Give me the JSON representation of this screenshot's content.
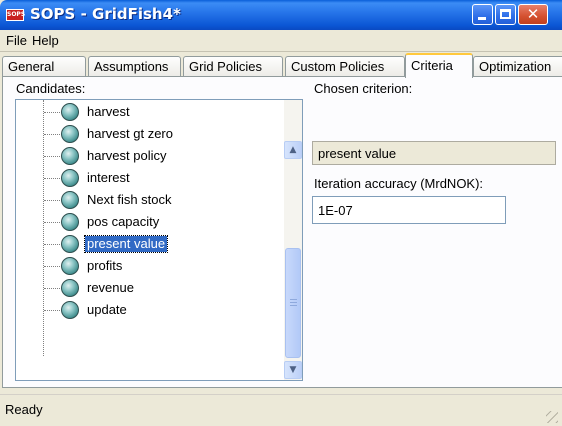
{
  "window": {
    "app_icon_text": "SOPS",
    "title": "SOPS - GridFish4*"
  },
  "menu": {
    "file": "File",
    "help": "Help"
  },
  "tabs": [
    {
      "label": "General"
    },
    {
      "label": "Assumptions"
    },
    {
      "label": "Grid Policies"
    },
    {
      "label": "Custom Policies"
    },
    {
      "label": "Criteria"
    },
    {
      "label": "Optimization"
    }
  ],
  "candidates": {
    "label": "Candidates:",
    "items": [
      {
        "label": "harvest"
      },
      {
        "label": "harvest gt zero"
      },
      {
        "label": "harvest policy"
      },
      {
        "label": "interest"
      },
      {
        "label": "Next fish stock"
      },
      {
        "label": "pos capacity"
      },
      {
        "label": "present value"
      },
      {
        "label": "profits"
      },
      {
        "label": "revenue"
      },
      {
        "label": "update"
      }
    ],
    "selected": "present value"
  },
  "chosen": {
    "label": "Chosen criterion:",
    "value": "present value"
  },
  "iteration": {
    "label": "Iteration accuracy (MrdNOK):",
    "value": "1E-07"
  },
  "status": {
    "text": "Ready"
  },
  "icons": {
    "app": "sops-app-icon",
    "item": "sphere-icon"
  },
  "colors": {
    "titlebar": "#0b56d4",
    "selection": "#316ac5",
    "active_tab_highlight": "#ffc83c"
  }
}
